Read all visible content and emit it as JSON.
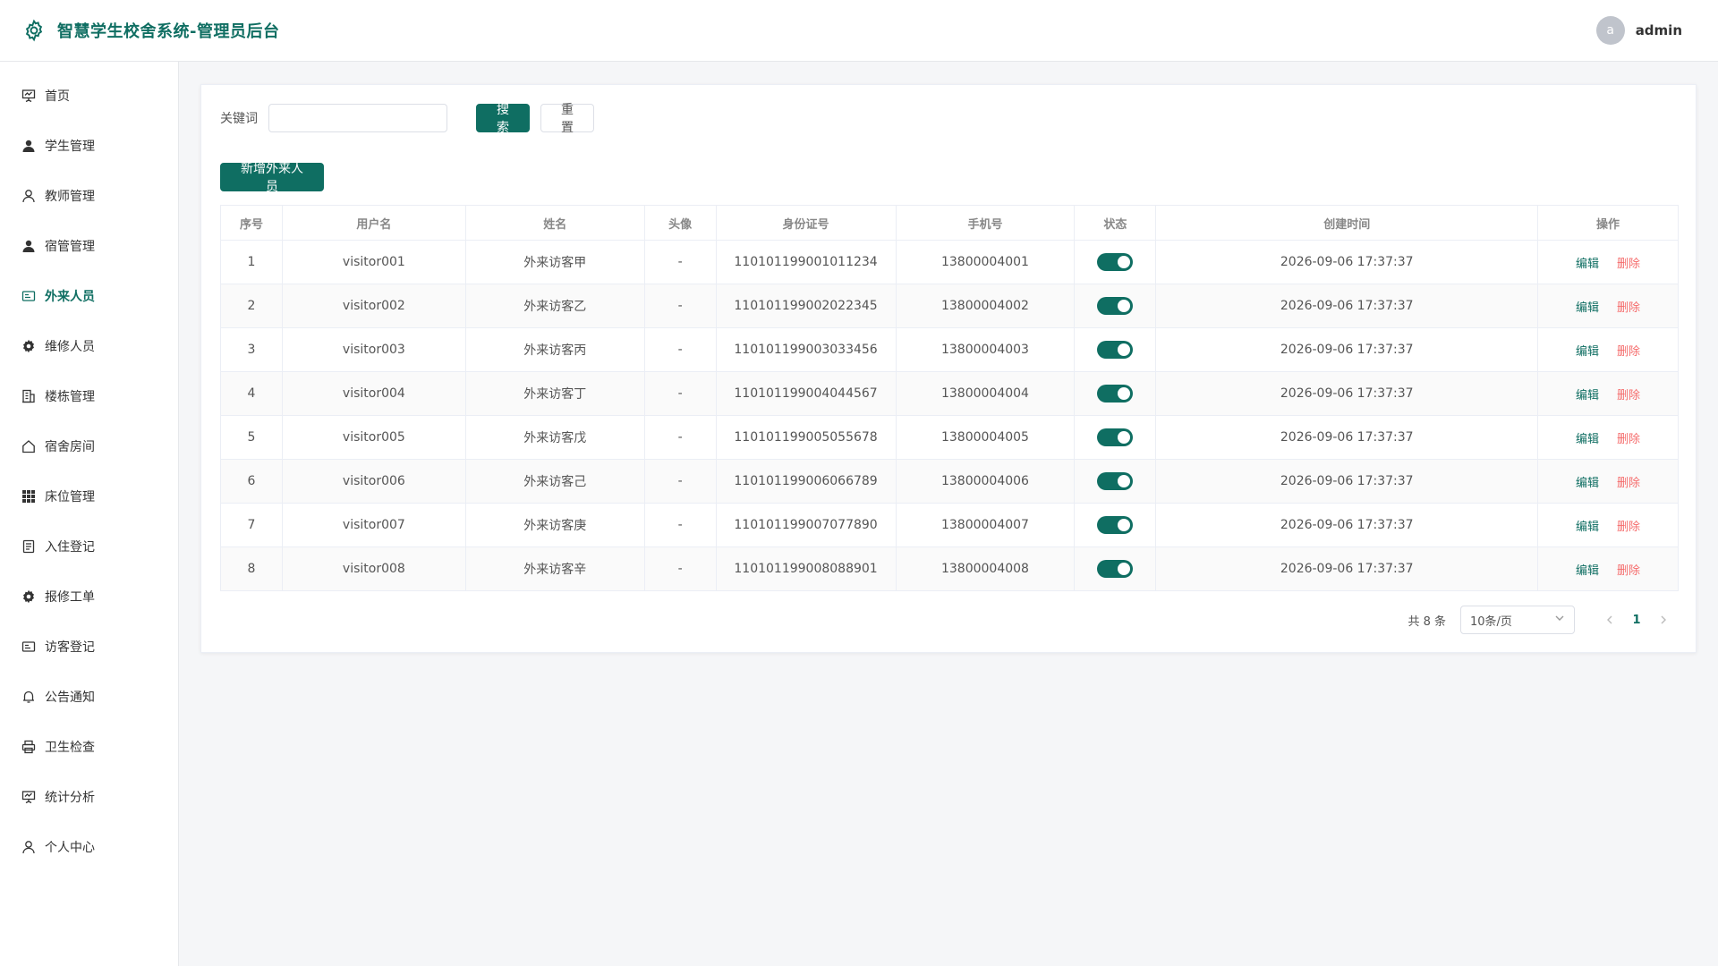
{
  "app": {
    "title": "智慧学生校舍系统-管理员后台"
  },
  "user": {
    "avatar_letter": "a",
    "name": "admin"
  },
  "colors": {
    "primary": "#0f6e62",
    "danger": "#f56c6c"
  },
  "sidebar": {
    "items": [
      {
        "label": "首页",
        "icon": "presentation-icon"
      },
      {
        "label": "学生管理",
        "icon": "user-filled-icon"
      },
      {
        "label": "教师管理",
        "icon": "user-outline-icon"
      },
      {
        "label": "宿管管理",
        "icon": "user-filled-icon"
      },
      {
        "label": "外来人员",
        "icon": "id-card-icon",
        "active": true
      },
      {
        "label": "维修人员",
        "icon": "gear-icon"
      },
      {
        "label": "楼栋管理",
        "icon": "building-icon"
      },
      {
        "label": "宿舍房间",
        "icon": "house-icon"
      },
      {
        "label": "床位管理",
        "icon": "grid-icon"
      },
      {
        "label": "入住登记",
        "icon": "document-icon"
      },
      {
        "label": "报修工单",
        "icon": "gear-icon"
      },
      {
        "label": "访客登记",
        "icon": "id-card-icon"
      },
      {
        "label": "公告通知",
        "icon": "bell-icon"
      },
      {
        "label": "卫生检查",
        "icon": "printer-icon"
      },
      {
        "label": "统计分析",
        "icon": "presentation-icon"
      },
      {
        "label": "个人中心",
        "icon": "user-outline-icon"
      }
    ]
  },
  "search": {
    "label": "关键词",
    "value": "",
    "placeholder": "",
    "search_label": "搜索",
    "reset_label": "重置"
  },
  "toolbar": {
    "add_label": "新增外来人员"
  },
  "table": {
    "columns": [
      "序号",
      "用户名",
      "姓名",
      "头像",
      "身份证号",
      "手机号",
      "状态",
      "创建时间",
      "操作"
    ],
    "rows": [
      {
        "index": "1",
        "username": "visitor001",
        "name": "外来访客甲",
        "avatar": "-",
        "id_number": "110101199001011234",
        "phone": "13800004001",
        "status": true,
        "created": "2026-09-06 17:37:37"
      },
      {
        "index": "2",
        "username": "visitor002",
        "name": "外来访客乙",
        "avatar": "-",
        "id_number": "110101199002022345",
        "phone": "13800004002",
        "status": true,
        "created": "2026-09-06 17:37:37"
      },
      {
        "index": "3",
        "username": "visitor003",
        "name": "外来访客丙",
        "avatar": "-",
        "id_number": "110101199003033456",
        "phone": "13800004003",
        "status": true,
        "created": "2026-09-06 17:37:37"
      },
      {
        "index": "4",
        "username": "visitor004",
        "name": "外来访客丁",
        "avatar": "-",
        "id_number": "110101199004044567",
        "phone": "13800004004",
        "status": true,
        "created": "2026-09-06 17:37:37"
      },
      {
        "index": "5",
        "username": "visitor005",
        "name": "外来访客戊",
        "avatar": "-",
        "id_number": "110101199005055678",
        "phone": "13800004005",
        "status": true,
        "created": "2026-09-06 17:37:37"
      },
      {
        "index": "6",
        "username": "visitor006",
        "name": "外来访客己",
        "avatar": "-",
        "id_number": "110101199006066789",
        "phone": "13800004006",
        "status": true,
        "created": "2026-09-06 17:37:37"
      },
      {
        "index": "7",
        "username": "visitor007",
        "name": "外来访客庚",
        "avatar": "-",
        "id_number": "110101199007077890",
        "phone": "13800004007",
        "status": true,
        "created": "2026-09-06 17:37:37"
      },
      {
        "index": "8",
        "username": "visitor008",
        "name": "外来访客辛",
        "avatar": "-",
        "id_number": "110101199008088901",
        "phone": "13800004008",
        "status": true,
        "created": "2026-09-06 17:37:37"
      }
    ],
    "edit_label": "编辑",
    "delete_label": "删除"
  },
  "pagination": {
    "total_text": "共 8 条",
    "page_size": "10条/页",
    "current_page": "1"
  }
}
